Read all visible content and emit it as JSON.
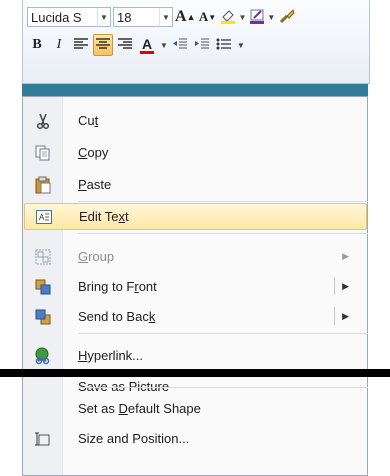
{
  "toolbar": {
    "font_name": "Lucida S",
    "font_size": "18",
    "grow_font_glyph": "A",
    "shrink_font_glyph": "A",
    "bold_glyph": "B",
    "italic_glyph": "I",
    "font_color_glyph": "A",
    "accent_active_bg": "#f7c35d"
  },
  "menu": {
    "cut": {
      "pre": "Cu",
      "u": "t",
      "post": ""
    },
    "copy": {
      "pre": "",
      "u": "C",
      "post": "opy"
    },
    "paste": {
      "pre": "",
      "u": "P",
      "post": "aste"
    },
    "edit_text": {
      "pre": "Edit Te",
      "u": "x",
      "post": "t"
    },
    "group": {
      "pre": "",
      "u": "G",
      "post": "roup"
    },
    "bring_front": {
      "pre": "Bring to F",
      "u": "r",
      "post": "ont"
    },
    "send_back": {
      "pre": "Send to Bac",
      "u": "k",
      "post": ""
    },
    "hyperlink": {
      "pre": "",
      "u": "H",
      "post": "yperlink..."
    },
    "save_picture": {
      "pre": "Save as Picture",
      "u": "",
      "post": ""
    },
    "default_shape": {
      "pre": "Set as ",
      "u": "D",
      "post": "efault Shape"
    },
    "size_position": {
      "pre": "Size and Position...",
      "u": "",
      "post": ""
    }
  },
  "colors": {
    "menu_highlight": "#fde8a6",
    "blue_bg": "#2f7d99"
  }
}
